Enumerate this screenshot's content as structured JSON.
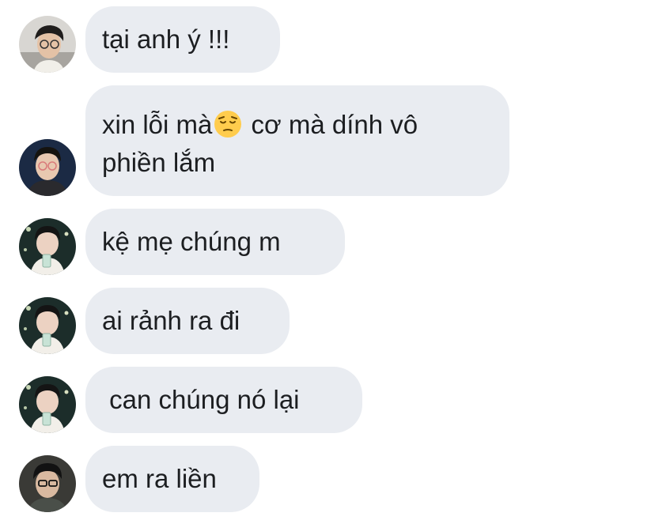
{
  "conversation": {
    "messages": [
      {
        "avatar": "avatar-boy-glasses-selfie",
        "text": "tại anh ý !!!"
      },
      {
        "avatar": "avatar-boy-glasses-hoodie",
        "text_before_emoji": "xin lỗi mà",
        "emoji": "pensive-face-icon",
        "text_after_emoji": " cơ mà dính vô",
        "text_line2": "phiền lắm"
      },
      {
        "avatar": "avatar-boy-drink",
        "text": "kệ mẹ chúng m"
      },
      {
        "avatar": "avatar-boy-drink",
        "text": "ai rảnh ra đi"
      },
      {
        "avatar": "avatar-boy-drink",
        "text": " can chúng nó lại"
      },
      {
        "avatar": "avatar-boy-glasses-dark",
        "text": "em ra liền"
      }
    ]
  },
  "colors": {
    "bubble_background": "#e9ecf1",
    "text": "#1c1e21",
    "page_background": "#ffffff"
  }
}
